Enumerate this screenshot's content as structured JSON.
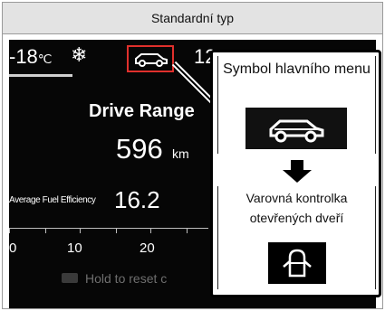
{
  "header": {
    "title": "Standardní typ"
  },
  "dashboard": {
    "temperature": "-18",
    "temp_unit": "℃",
    "snow_glyph": "❄",
    "partial_value": "12",
    "drive_range_label": "Drive Range",
    "drive_range_value": "596",
    "drive_range_unit": "km",
    "avg_fuel_label": "Average Fuel Efficiency",
    "avg_fuel_value": "16.2",
    "scale_labels": [
      "0",
      "10",
      "20"
    ],
    "hold_text": "Hold to reset c"
  },
  "callout": {
    "main_menu_label": "Symbol hlavního menu",
    "warning_label": "Varovná kontrolka otevřených dveří"
  },
  "colors": {
    "highlight": "#e0302c",
    "panel": "#060606",
    "header_bg": "#e3e3e3"
  },
  "icons": {
    "main_menu": "car-side-icon",
    "door": "car-door-open-icon",
    "arrow": "arrow-down-icon"
  }
}
